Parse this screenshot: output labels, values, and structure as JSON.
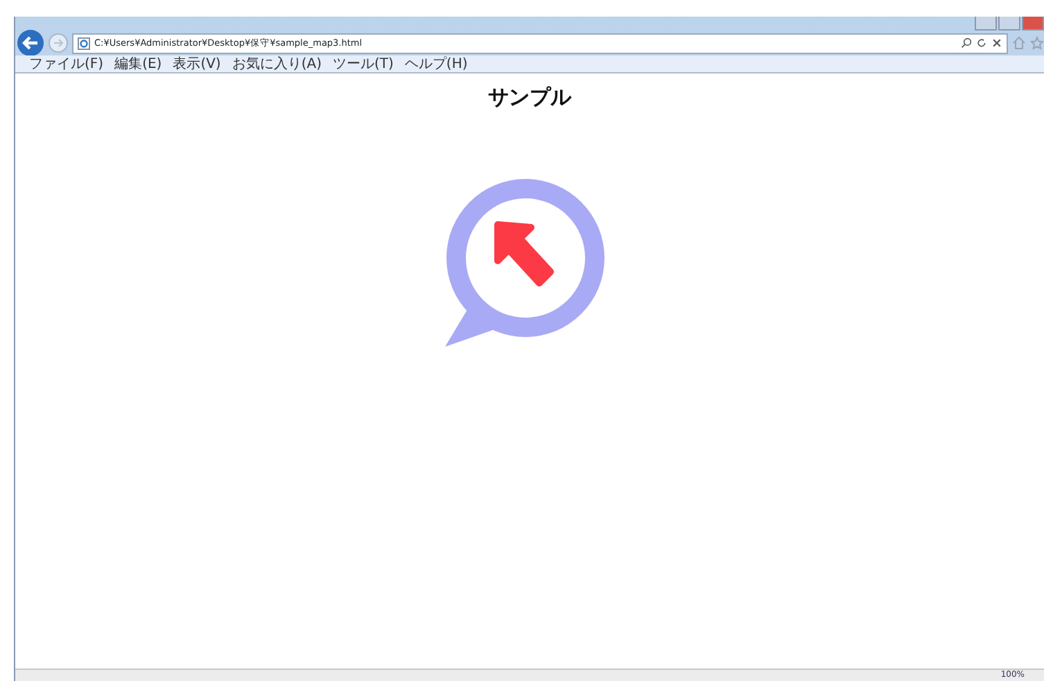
{
  "address_bar": {
    "url": "C:¥Users¥Administrator¥Desktop¥保守¥sample_map3.html"
  },
  "menu": [
    "ファイル(F)",
    "編集(E)",
    "表示(V)",
    "お気に入り(A)",
    "ツール(T)",
    "ヘルプ(H)"
  ],
  "page": {
    "heading": "サンプル"
  },
  "status_bar": {
    "zoom": "100%"
  }
}
